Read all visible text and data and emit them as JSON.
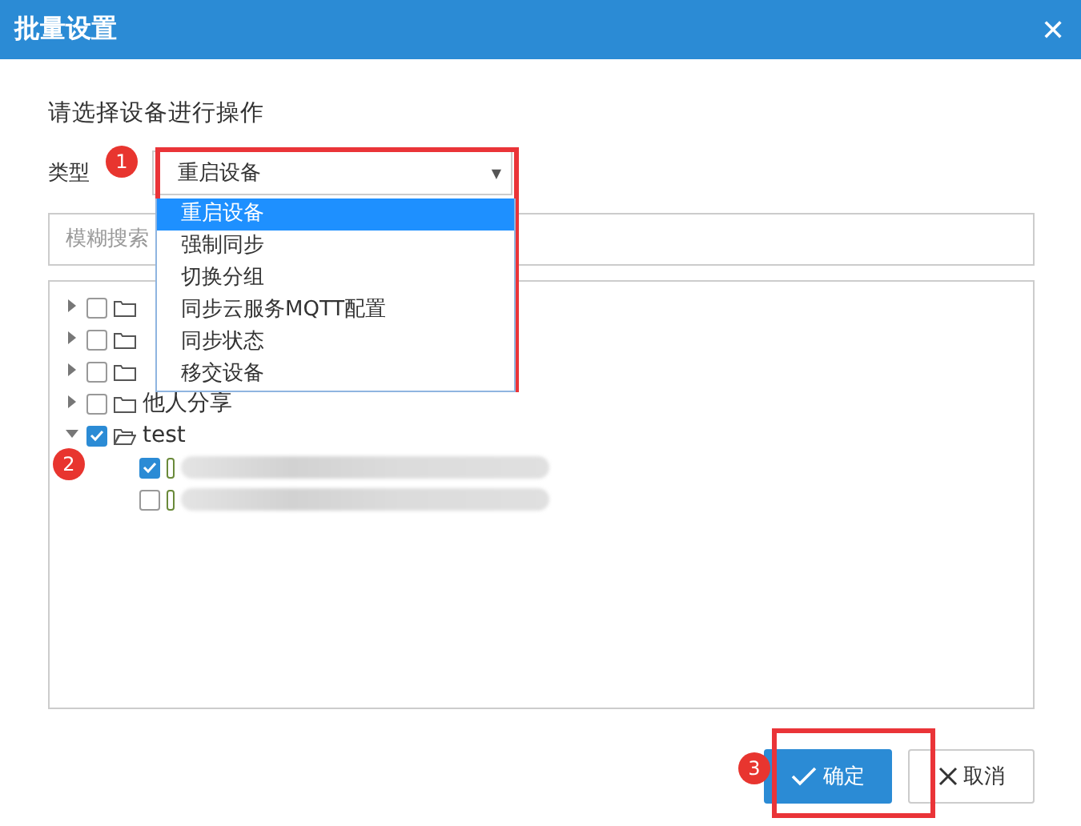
{
  "window": {
    "title": "批量设置",
    "close": "✕"
  },
  "prompt": "请选择设备进行操作",
  "type_field": {
    "label": "类型",
    "value": "重启设备",
    "arrow": "▼",
    "expanded": true,
    "options": [
      {
        "label": "重启设备",
        "selected": true
      },
      {
        "label": "强制同步",
        "selected": false
      },
      {
        "label": "切换分组",
        "selected": false
      },
      {
        "label": "同步云服务MQTT配置",
        "selected": false
      },
      {
        "label": "同步状态",
        "selected": false
      },
      {
        "label": "移交设备",
        "selected": false
      }
    ]
  },
  "search": {
    "placeholder": "模糊搜索"
  },
  "tree": [
    {
      "kind": "folder",
      "expanded": false,
      "checked": false
    },
    {
      "kind": "folder",
      "expanded": false,
      "checked": false
    },
    {
      "kind": "folder",
      "expanded": false,
      "checked": false
    },
    {
      "kind": "folder",
      "label": "他人分享",
      "expanded": false,
      "checked": false
    },
    {
      "kind": "folder",
      "label": "test",
      "expanded": true,
      "checked": true,
      "children": [
        {
          "kind": "device",
          "checked": true
        },
        {
          "kind": "device",
          "checked": false
        }
      ]
    }
  ],
  "buttons": [
    {
      "label": "确定",
      "kind": "primary"
    },
    {
      "label": "取消",
      "kind": "cancel"
    }
  ],
  "annotations": [
    {
      "number": "1"
    },
    {
      "number": "2"
    },
    {
      "number": "3"
    }
  ]
}
